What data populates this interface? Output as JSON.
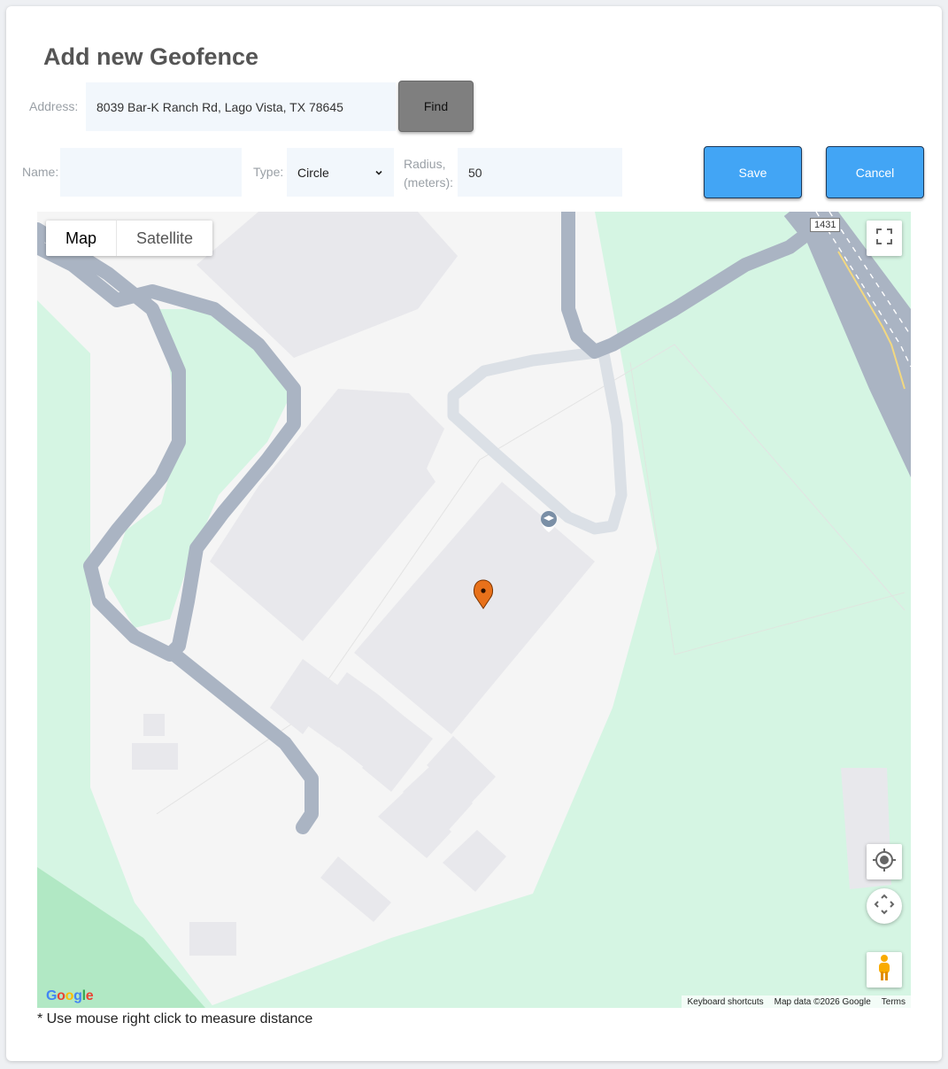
{
  "page": {
    "title": "Add new Geofence"
  },
  "address": {
    "label": "Address:",
    "value": "8039 Bar-K Ranch Rd, Lago Vista, TX 78645",
    "find_label": "Find"
  },
  "name": {
    "label": "Name:",
    "value": ""
  },
  "type": {
    "label": "Type:",
    "selected": "Circle"
  },
  "radius": {
    "label_line1": "Radius,",
    "label_line2": "(meters):",
    "value": "50"
  },
  "actions": {
    "save_label": "Save",
    "cancel_label": "Cancel"
  },
  "map": {
    "map_type_options": [
      "Map",
      "Satellite"
    ],
    "highway_shield": "1431",
    "attribution": {
      "keyboard": "Keyboard shortcuts",
      "data": "Map data ©2026 Google",
      "terms": "Terms"
    },
    "logo": "Google",
    "marker_color": "#e8711a"
  },
  "footer_note": "* Use mouse right click to measure distance"
}
